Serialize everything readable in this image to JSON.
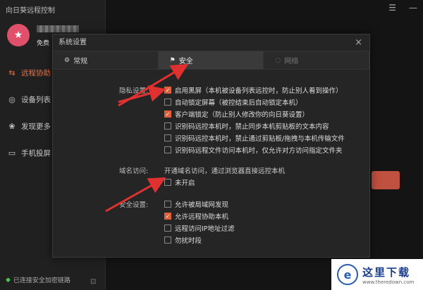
{
  "app": {
    "title": "向日葵远程控制"
  },
  "window_controls": {
    "minimize": "—",
    "menu": "☰"
  },
  "user": {
    "type": "免费"
  },
  "sidebar": {
    "items": [
      {
        "label": "远程协助",
        "icon": "remote-assist-icon",
        "active": true
      },
      {
        "label": "设备列表",
        "icon": "device-list-icon"
      },
      {
        "label": "发现更多",
        "icon": "discover-icon"
      },
      {
        "label": "手机投屏",
        "icon": "screen-cast-icon"
      }
    ],
    "secure_status": "已连接安全加密链路"
  },
  "dialog": {
    "title": "系统设置",
    "close": "×",
    "tabs": [
      {
        "label": "常规",
        "icon": "gear-icon"
      },
      {
        "label": "安全",
        "icon": "shield-icon",
        "active": true
      },
      {
        "label": "网络",
        "icon": "network-icon"
      }
    ],
    "privacy": {
      "label": "隐私设置:",
      "options": [
        {
          "label": "启用黑屏（本机被设备列表远控时，防止别人看到操作）",
          "checked": true
        },
        {
          "label": "自动锁定屏幕（被控结束后自动锁定本机）",
          "checked": false
        },
        {
          "label": "客户端锁定（防止别人修改你的向日葵设置）",
          "checked": true
        },
        {
          "label": "识别码远控本机时，禁止同步本机剪贴板的文本内容",
          "checked": false
        },
        {
          "label": "识别码远控本机时，禁止通过剪贴板/拖拽与本机传输文件",
          "checked": false
        },
        {
          "label": "识别码远程文件访问本机时，仅允许对方访问指定文件夹",
          "checked": false
        }
      ]
    },
    "domain": {
      "label": "域名访问:",
      "note": "开通域名访问，通过浏览器直接远控本机",
      "option": {
        "label": "未开启",
        "checked": false
      }
    },
    "security": {
      "label": "安全设置:",
      "options": [
        {
          "label": "允许被局域网发现",
          "checked": false
        },
        {
          "label": "允许远程协助本机",
          "checked": true
        },
        {
          "label": "远程访问IP地址过滤",
          "checked": false
        },
        {
          "label": "勿扰时段",
          "checked": false
        }
      ]
    }
  },
  "watermark": {
    "cn": "这里下载",
    "url": "www.theredown.com",
    "logo": "e"
  },
  "colors": {
    "accent": "#e0603a",
    "arrow": "#e03030"
  }
}
